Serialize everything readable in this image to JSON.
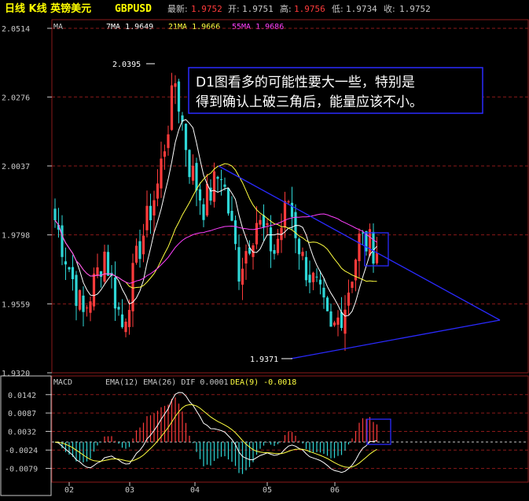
{
  "header": {
    "title": "日线 K线 英镑美元",
    "symbol": "GBPUSD",
    "last_label": "最新:",
    "last": "1.9752",
    "open_label": "开:",
    "open": "1.9751",
    "high_label": "高:",
    "high": "1.9756",
    "low_label": "低:",
    "low": "1.9734",
    "close_label": "收:",
    "close": "1.9752"
  },
  "ma_legend": {
    "label": "MA",
    "ma7": "7MA 1.9649",
    "ma21": "21MA 1.9666",
    "ma55": "55MA 1.9686"
  },
  "macd_legend": {
    "label": "MACD",
    "text": "EMA(12) EMA(26) DIF 0.0001",
    "dea": "DEA(9) -0.0018"
  },
  "annotation": {
    "line1": "D1图看多的可能性要大一些，特别是",
    "line2": "得到确认上破三角后，能量应该不小。"
  },
  "marks": {
    "high_label": "2.0395",
    "low_label": "1.9371"
  },
  "colors": {
    "up": "#ff3b3b",
    "down": "#2ed6d6",
    "ma7": "#ffffff",
    "ma21": "#ffff40",
    "ma55": "#ff40ff",
    "triangle": "#2a2aff",
    "grid": "#8c1a1a",
    "axis_text": "#c8c8c8"
  },
  "chart_data": [
    {
      "type": "candlestick",
      "y_ticks": [
        2.0514,
        2.0276,
        2.0037,
        1.9798,
        1.9559,
        1.932
      ],
      "ylim": [
        1.932,
        2.0514
      ],
      "x_ticks": [
        "02",
        "03",
        "04",
        "05",
        "06"
      ],
      "annotated_high": 2.0395,
      "annotated_low": 1.9371,
      "last_candle": {
        "open": 1.9751,
        "high": 1.9756,
        "low": 1.9734,
        "close": 1.9752
      },
      "series": [
        {
          "name": "7MA",
          "last": 1.9649
        },
        {
          "name": "21MA",
          "last": 1.9666
        },
        {
          "name": "55MA",
          "last": 1.9686
        }
      ]
    },
    {
      "type": "bar",
      "y_ticks": [
        0.0142,
        0.0087,
        0.0032,
        -0.0024,
        -0.0079
      ],
      "ylim": [
        -0.012,
        0.0165
      ],
      "series": [
        {
          "name": "DIF",
          "last": 0.0001
        },
        {
          "name": "DEA(9)",
          "last": -0.0018
        }
      ]
    }
  ]
}
